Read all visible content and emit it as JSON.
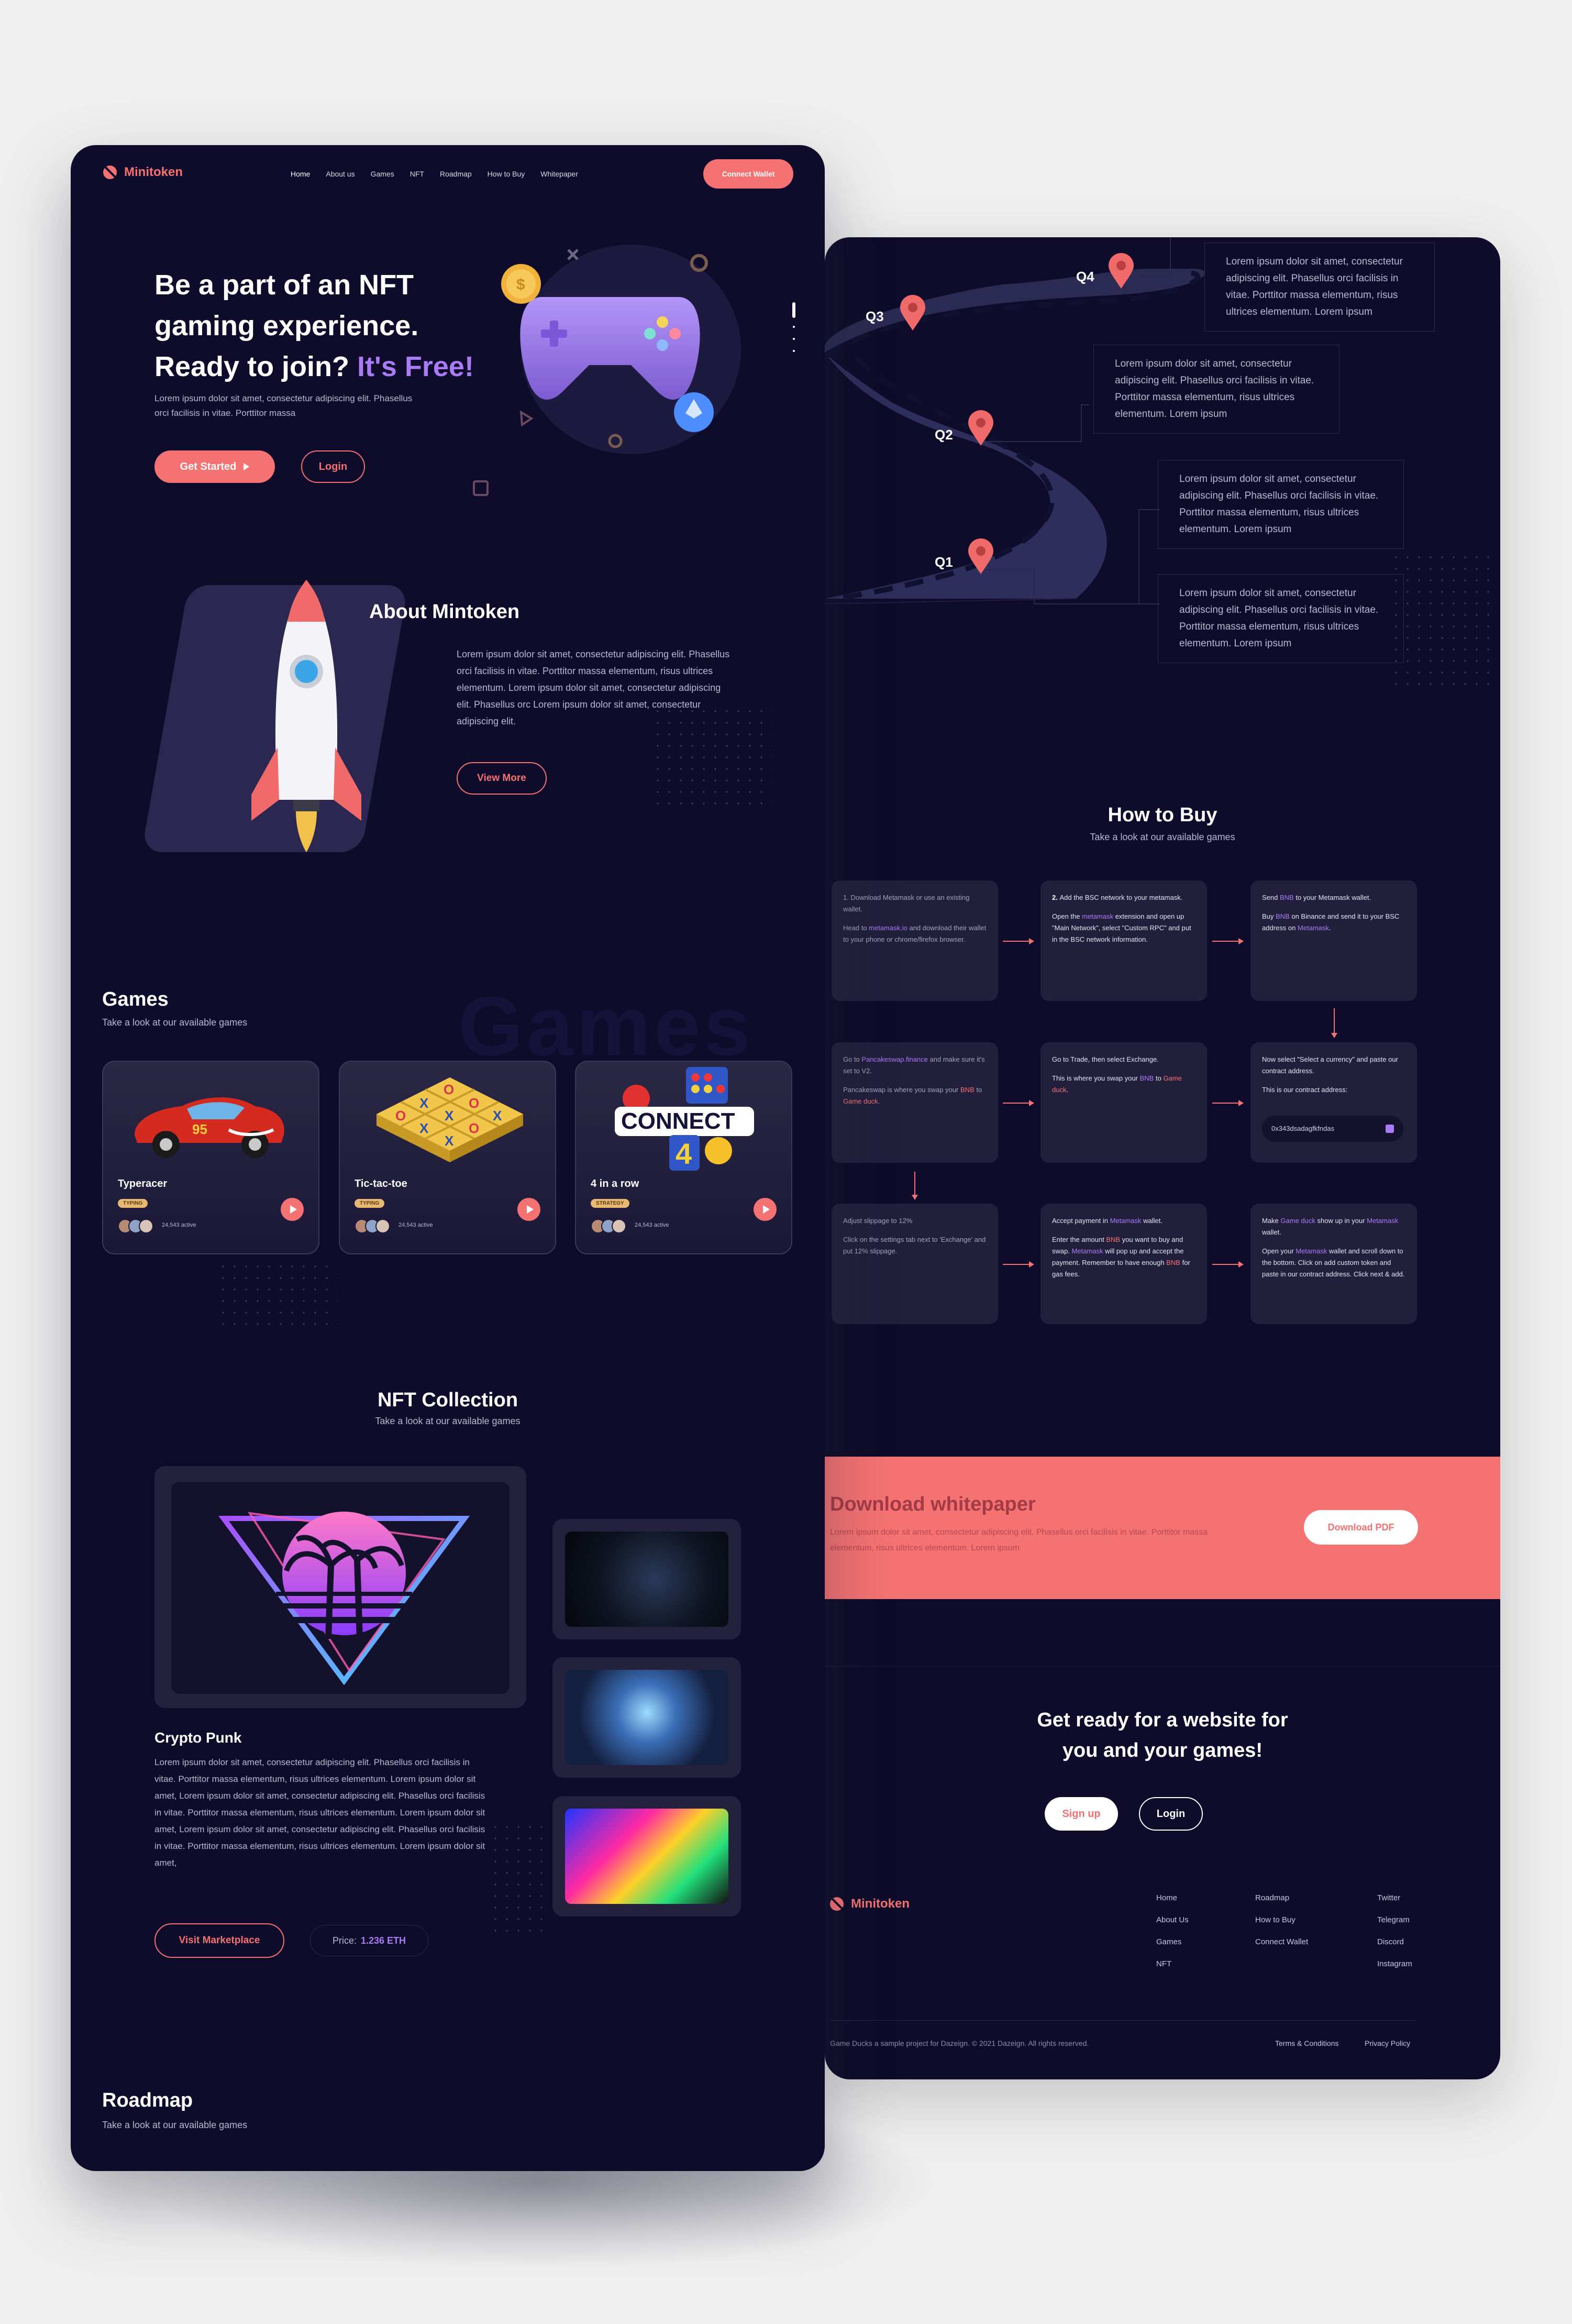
{
  "brand": {
    "name": "Minitoken"
  },
  "nav": {
    "items": [
      "Home",
      "About us",
      "Games",
      "NFT",
      "Roadmap",
      "How to Buy",
      "Whitepaper"
    ],
    "cta": "Connect Wallet"
  },
  "hero": {
    "line1": "Be a part of an NFT",
    "line2": "gaming experience.",
    "line3_plain": "Ready to join?",
    "line3_accent": "It's Free!",
    "body": "Lorem ipsum dolor sit amet, consectetur adipiscing elit. Phasellus orci facilisis in vitae. Porttitor massa",
    "primary": "Get Started",
    "secondary": "Login"
  },
  "about": {
    "title": "About Mintoken",
    "body": "Lorem ipsum dolor sit amet, consectetur adipiscing elit. Phasellus orci facilisis in vitae. Porttitor massa elementum, risus ultrices elementum. Lorem ipsum dolor sit amet, consectetur adipiscing elit. Phasellus orc Lorem ipsum dolor sit amet, consectetur adipiscing elit.",
    "button": "View More"
  },
  "games": {
    "title": "Games",
    "subtitle": "Take a look at our available games",
    "watermark": "Games",
    "cards": [
      {
        "name": "Typeracer",
        "tag": "TYPING",
        "active": "24,543 active"
      },
      {
        "name": "Tic-tac-toe",
        "tag": "TYPING",
        "active": "24,543 active"
      },
      {
        "name": "4 in a row",
        "tag": "STRATEGY",
        "active": "24,543 active"
      }
    ]
  },
  "nft": {
    "title": "NFT Collection",
    "subtitle": "Take a look at our available games",
    "item_title": "Crypto Punk",
    "item_body": "Lorem ipsum dolor sit amet, consectetur adipiscing elit. Phasellus orci facilisis in vitae. Porttitor massa elementum, risus ultrices elementum. Lorem ipsum dolor sit amet, Lorem ipsum dolor sit amet, consectetur adipiscing elit. Phasellus orci facilisis in vitae. Porttitor massa elementum, risus ultrices elementum. Lorem ipsum dolor sit amet, Lorem ipsum dolor sit amet, consectetur adipiscing elit. Phasellus orci facilisis in vitae. Porttitor massa elementum, risus ultrices elementum. Lorem ipsum dolor sit amet,",
    "marketplace": "Visit Marketplace",
    "price_label": "Price:",
    "price_value": "1.236 ETH"
  },
  "roadmap": {
    "title": "Roadmap",
    "subtitle": "Take a look at our available games",
    "quarters": [
      "Q1",
      "Q2",
      "Q3",
      "Q4"
    ],
    "box_text": "Lorem ipsum dolor sit amet, consectetur adipiscing elit. Phasellus orci facilisis in vitae. Porttitor massa elementum, risus ultrices elementum. Lorem ipsum"
  },
  "howto": {
    "title": "How to Buy",
    "subtitle": "Take a look at our available games",
    "contract": "0x343dsadagfkfndas"
  },
  "whitepaper": {
    "title": "Download whitepaper",
    "body": "Lorem ipsum dolor sit amet, consectetur adipiscing elit. Phasellus orci facilisis in vitae. Porttitor massa elementum, risus ultrices elementum. Lorem ipsum",
    "button": "Download PDF"
  },
  "cta": {
    "line1": "Get ready for a website for",
    "line2": "you and your games!",
    "signup": "Sign up",
    "login": "Login"
  },
  "footer": {
    "col1": [
      "Home",
      "About Us",
      "Games",
      "NFT"
    ],
    "col2": [
      "Roadmap",
      "How to Buy",
      "Connect Wallet"
    ],
    "col3": [
      "Twitter",
      "Telegram",
      "Discord",
      "Instagram"
    ],
    "copyright": "Game Ducks a sample project for Dazeign. © 2021 Dazeign. All rights reserved.",
    "terms": "Terms & Conditions",
    "privacy": "Privacy Policy"
  },
  "colors": {
    "bg": "#0e0c2a",
    "coral": "#f47272",
    "purple": "#a97cf5",
    "card": "#221f3d"
  }
}
